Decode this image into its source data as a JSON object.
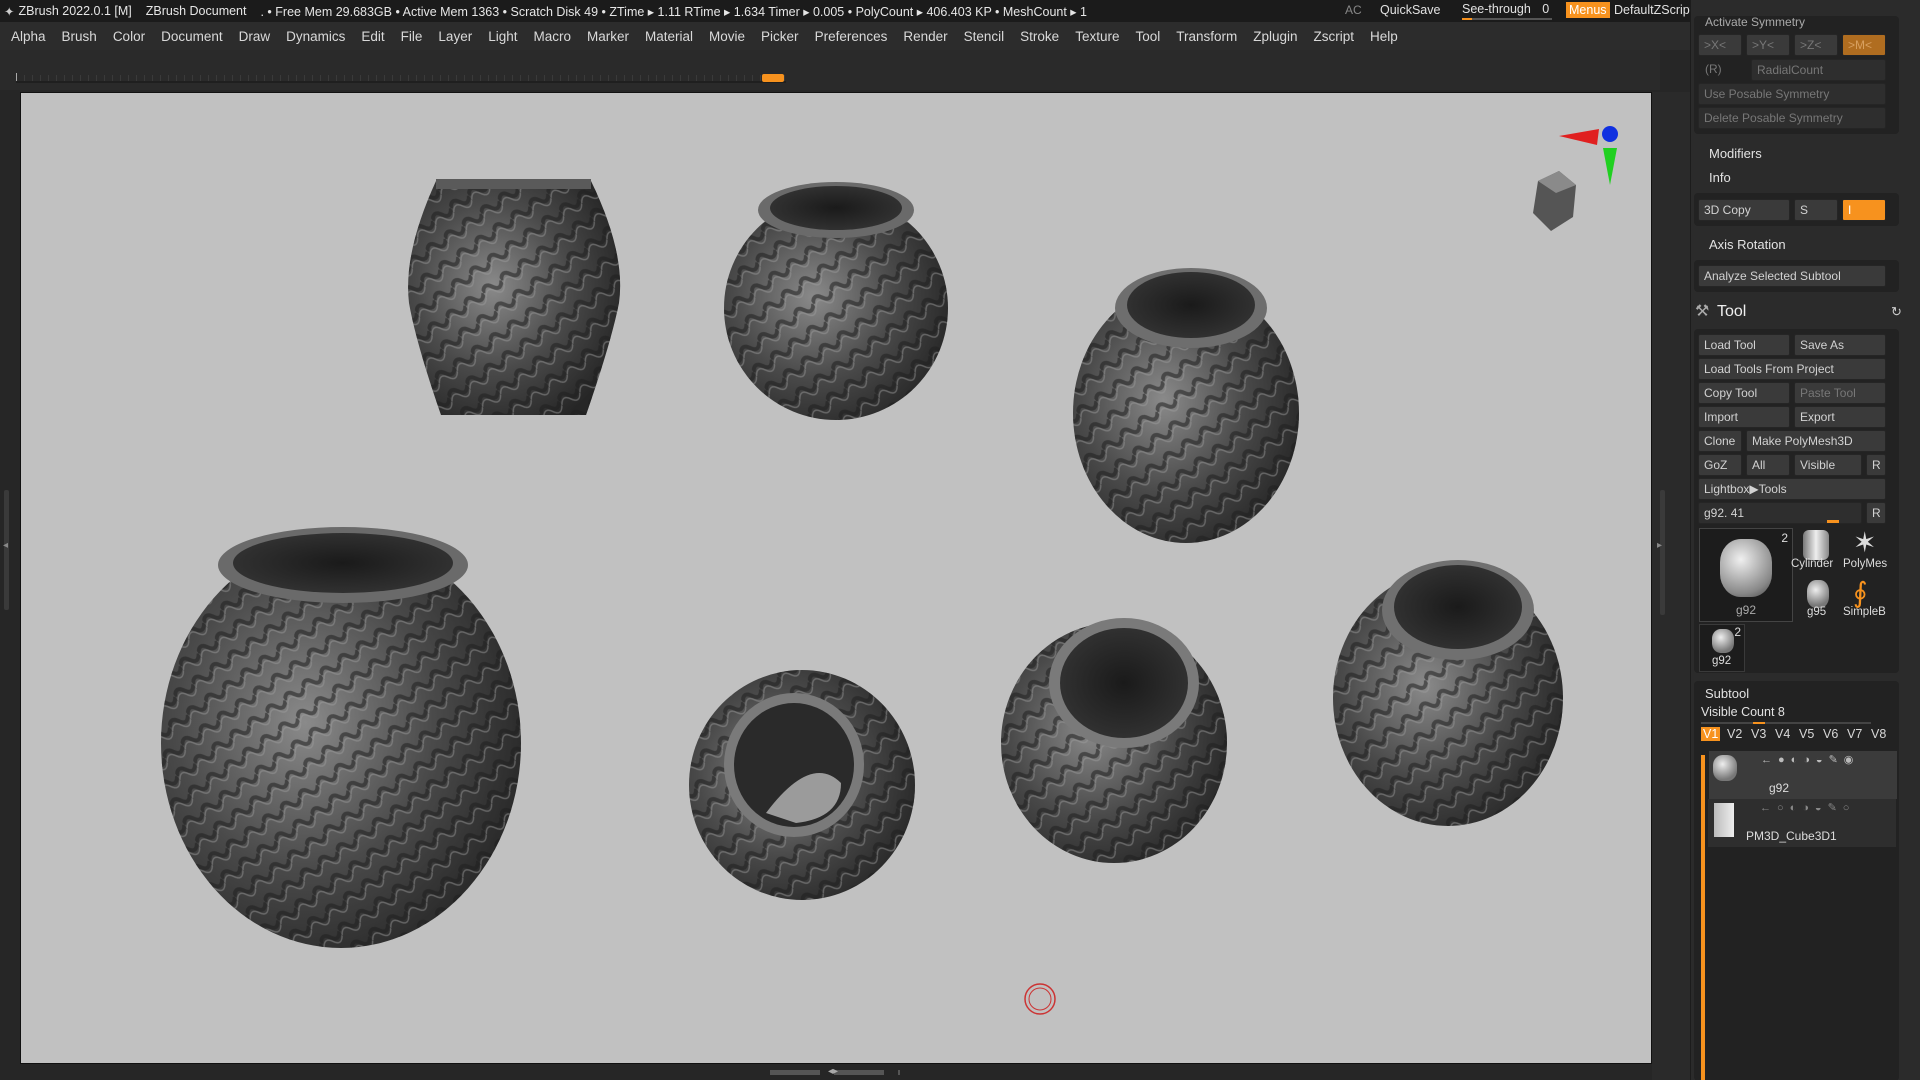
{
  "titlebar": {
    "app": "ZBrush 2022.0.1 [M]",
    "document": "ZBrush Document",
    "stats": ". • Free Mem 29.683GB • Active Mem 1363 • Scratch Disk 49 •  ZTime ▸ 1.11 RTime ▸ 1.634 Timer ▸ 0.005 • PolyCount ▸ 406.403 KP  • MeshCount ▸ 1",
    "ac": "AC",
    "quicksave": "QuickSave",
    "seethrough": "See-through",
    "seethrough_value": "0",
    "menus": "Menus",
    "script": "DefaultZScript",
    "window_icons": [
      "◀▮▶",
      "⧉",
      "⧉",
      "─",
      "⧉",
      "✕"
    ]
  },
  "menubar": {
    "items": [
      "Alpha",
      "Brush",
      "Color",
      "Document",
      "Draw",
      "Dynamics",
      "Edit",
      "File",
      "Layer",
      "Light",
      "Macro",
      "Marker",
      "Material",
      "Movie",
      "Picker",
      "Preferences",
      "Render",
      "Stencil",
      "Stroke",
      "Texture",
      "Tool",
      "Transform",
      "Zplugin",
      "Zscript",
      "Help"
    ]
  },
  "symmetry": {
    "header": "Activate Symmetry",
    "x": ">X<",
    "y": ">Y<",
    "z": ">Z<",
    "m": ">M<",
    "r": "(R)",
    "radial": "RadialCount",
    "use_posable": "Use Posable Symmetry",
    "delete_posable": "Delete Posable Symmetry"
  },
  "transform_extra": {
    "modifiers": "Modifiers",
    "info": "Info",
    "copy3d": "3D Copy",
    "s": "S",
    "i": "I",
    "axis_rotation": "Axis Rotation",
    "analyze": "Analyze Selected Subtool"
  },
  "tool": {
    "title": "Tool",
    "load_tool": "Load Tool",
    "save_as": "Save As",
    "load_from_project": "Load Tools From Project",
    "copy_tool": "Copy Tool",
    "paste_tool": "Paste Tool",
    "import": "Import",
    "export": "Export",
    "clone": "Clone",
    "make_polymesh": "Make PolyMesh3D",
    "goz": "GoZ",
    "all": "All",
    "visible": "Visible",
    "r": "R",
    "lightbox": "Lightbox▶Tools",
    "current": "g92. 41",
    "current_r": "R",
    "thumbs": [
      {
        "label": "g92",
        "count": "2"
      },
      {
        "label": "Cylinder"
      },
      {
        "label": "PolyMes"
      },
      {
        "label": "g95"
      },
      {
        "label": "SimpleB"
      },
      {
        "label": "g92",
        "count": "2"
      }
    ]
  },
  "subtool": {
    "title": "Subtool",
    "visible_count": "Visible Count 8",
    "tabs": [
      "V1",
      "V2",
      "V3",
      "V4",
      "V5",
      "V6",
      "V7",
      "V8"
    ],
    "active_tab": "V1",
    "items": [
      {
        "name": "g92"
      },
      {
        "name": "PM3D_Cube3D1"
      }
    ]
  },
  "colors": {
    "accent": "#f7921e",
    "canvas": "#c1c1c1",
    "gizmo_x": "#e02020",
    "gizmo_y": "#20d020",
    "gizmo_z": "#1030e0"
  }
}
